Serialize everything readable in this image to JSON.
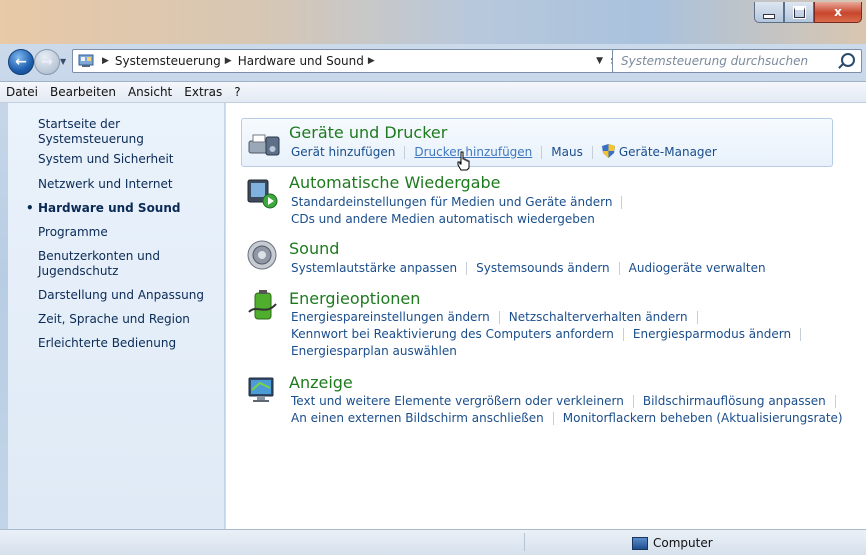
{
  "addressbar": {
    "crumbs": [
      "Systemsteuerung",
      "Hardware und Sound"
    ],
    "search_placeholder": "Systemsteuerung durchsuchen"
  },
  "menu": [
    "Datei",
    "Bearbeiten",
    "Ansicht",
    "Extras",
    "?"
  ],
  "sidebar": {
    "items": [
      {
        "label": "Startseite der Systemsteuerung"
      },
      {
        "label": "System und Sicherheit"
      },
      {
        "label": "Netzwerk und Internet"
      },
      {
        "label": "Hardware und Sound",
        "active": true
      },
      {
        "label": "Programme"
      },
      {
        "label": "Benutzerkonten und Jugendschutz"
      },
      {
        "label": "Darstellung und Anpassung"
      },
      {
        "label": "Zeit, Sprache und Region"
      },
      {
        "label": "Erleichterte Bedienung"
      }
    ]
  },
  "categories": [
    {
      "title": "Geräte und Drucker",
      "icon": "devices-printers-icon",
      "links": [
        "Gerät hinzufügen",
        "Drucker hinzufügen",
        "Maus",
        "Geräte-Manager"
      ]
    },
    {
      "title": "Automatische Wiedergabe",
      "icon": "autoplay-icon",
      "links": [
        "Standardeinstellungen für Medien und Geräte ändern",
        "CDs und andere Medien automatisch wiedergeben"
      ]
    },
    {
      "title": "Sound",
      "icon": "speaker-icon",
      "links": [
        "Systemlautstärke anpassen",
        "Systemsounds ändern",
        "Audiogeräte verwalten"
      ]
    },
    {
      "title": "Energieoptionen",
      "icon": "battery-icon",
      "links": [
        "Energiespareinstellungen ändern",
        "Netzschalterverhalten ändern",
        "Kennwort bei Reaktivierung des Computers anfordern",
        "Energiesparmodus ändern",
        "Energiesparplan auswählen"
      ]
    },
    {
      "title": "Anzeige",
      "icon": "monitor-icon",
      "links": [
        "Text und weitere Elemente vergrößern oder verkleinern",
        "Bildschirmauflösung anpassen",
        "An einen externen Bildschirm anschließen",
        "Monitorflackern beheben (Aktualisierungsrate)"
      ]
    }
  ],
  "statusbar": {
    "location": "Computer"
  }
}
